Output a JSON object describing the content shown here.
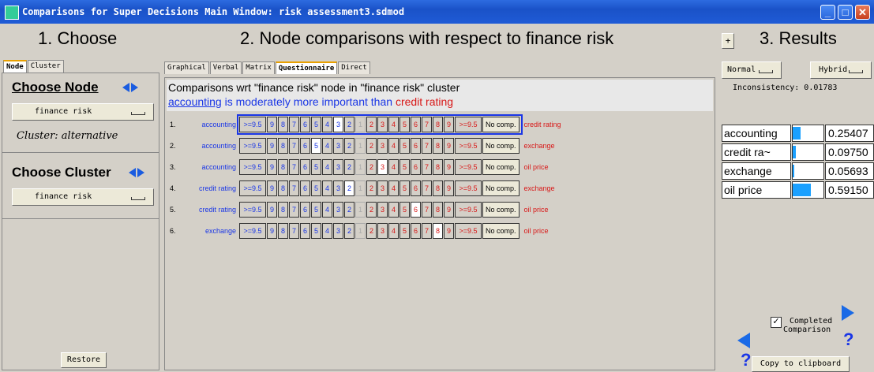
{
  "window": {
    "title": "Comparisons for Super Decisions Main Window: risk assessment3.sdmod"
  },
  "choose": {
    "title": "1. Choose",
    "tabs": [
      "Node",
      "Cluster"
    ],
    "node_heading": "Choose Node",
    "node_value": "finance risk",
    "cluster_note": "Cluster: alternative",
    "cluster_heading": "Choose Cluster",
    "cluster_value": "finance risk",
    "restore": "Restore"
  },
  "comparisons": {
    "title": "2. Node comparisons with respect to finance risk",
    "tabs": [
      "Graphical",
      "Verbal",
      "Matrix",
      "Questionnaire",
      "Direct"
    ],
    "active_tab": "Questionnaire",
    "heading": "Comparisons wrt \"finance risk\" node in \"finance risk\" cluster",
    "verbal": {
      "left": "accounting",
      "middle": " is moderately more important than ",
      "right": "credit rating"
    },
    "scale_left": [
      ">=9.5",
      "9",
      "8",
      "7",
      "6",
      "5",
      "4",
      "3",
      "2"
    ],
    "scale_one": "1",
    "scale_right": [
      "2",
      "3",
      "4",
      "5",
      "6",
      "7",
      "8",
      "9",
      ">=9.5"
    ],
    "no_comp": "No comp.",
    "rows": [
      {
        "num": "1.",
        "left": "accounting",
        "right": "credit rating",
        "side": "left",
        "value": "3"
      },
      {
        "num": "2.",
        "left": "accounting",
        "right": "exchange",
        "side": "left",
        "value": "5"
      },
      {
        "num": "3.",
        "left": "accounting",
        "right": "oil price",
        "side": "right",
        "value": "3"
      },
      {
        "num": "4.",
        "left": "credit rating",
        "right": "exchange",
        "side": "left",
        "value": "2"
      },
      {
        "num": "5.",
        "left": "credit rating",
        "right": "oil price",
        "side": "right",
        "value": "6"
      },
      {
        "num": "6.",
        "left": "exchange",
        "right": "oil price",
        "side": "right",
        "value": "8"
      }
    ]
  },
  "results": {
    "title": "3. Results",
    "plus": "+",
    "mode_left": "Normal",
    "mode_right": "Hybrid",
    "inconsistency": "Inconsistency: 0.01783",
    "rows": [
      {
        "name": "accounting",
        "value": "0.25407",
        "share": 0.254
      },
      {
        "name": "credit ra~",
        "value": "0.09750",
        "share": 0.0975
      },
      {
        "name": "exchange",
        "value": "0.05693",
        "share": 0.0569
      },
      {
        "name": "oil price",
        "value": "0.59150",
        "share": 0.5915
      }
    ],
    "completed_label_1": "Completed",
    "completed_label_2": "Comparison",
    "completed": true,
    "copy": "Copy to clipboard"
  },
  "colors": {
    "blue": "#1a36e6",
    "red": "#d81818",
    "bar": "#1aa0ff"
  }
}
